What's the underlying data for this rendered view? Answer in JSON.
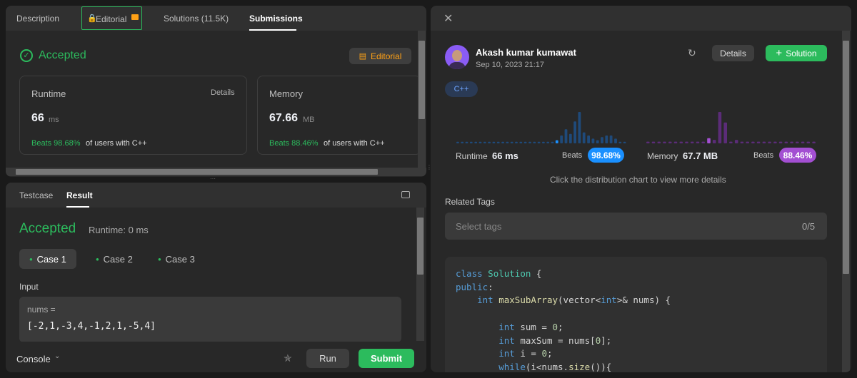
{
  "left_tabs": [
    {
      "label": "Description"
    },
    {
      "label": "Editorial"
    },
    {
      "label": "Solutions (11.5K)"
    },
    {
      "label": "Submissions"
    }
  ],
  "submission": {
    "status": "Accepted",
    "editorial_button": "Editorial",
    "runtime": {
      "title": "Runtime",
      "details": "Details",
      "value": "66",
      "unit": "ms",
      "beats": "Beats 98.68%",
      "suffix": "of users with C++"
    },
    "memory": {
      "title": "Memory",
      "value": "67.66",
      "unit": "MB",
      "beats": "Beats 88.46%",
      "suffix": "of users with C++"
    }
  },
  "bottom_panel": {
    "tabs": [
      {
        "label": "Testcase"
      },
      {
        "label": "Result"
      }
    ],
    "status": "Accepted",
    "runtime": "Runtime: 0 ms",
    "cases": [
      {
        "label": "Case 1"
      },
      {
        "label": "Case 2"
      },
      {
        "label": "Case 3"
      }
    ],
    "input_label": "Input",
    "input_name": "nums =",
    "input_value": "[-2,1,-3,4,-1,2,1,-5,4]",
    "console": "Console",
    "run": "Run",
    "submit": "Submit"
  },
  "detail": {
    "author": "Akash kumar kumawat",
    "date": "Sep 10, 2023 21:17",
    "details_button": "Details",
    "solution_button": "Solution",
    "language": "C++",
    "runtime_label": "Runtime",
    "runtime_value": "66 ms",
    "beats_label": "Beats",
    "runtime_beats": "98.68%",
    "memory_label": "Memory",
    "memory_value": "67.7 MB",
    "memory_beats": "88.46%",
    "hint": "Click the distribution chart to view more details",
    "related_tags": "Related Tags",
    "tags_placeholder": "Select tags",
    "tags_count": "0/5"
  },
  "colors": {
    "accent_green": "#2cbb5d",
    "accent_blue": "#1a90ff",
    "accent_purple": "#a34fd2",
    "editorial_orange": "#ffa116"
  },
  "runtime_distribution": [
    1,
    1,
    1,
    1,
    1,
    1,
    1,
    1,
    1,
    1,
    1,
    1,
    1,
    1,
    1,
    1,
    1,
    1,
    1,
    1,
    1,
    1,
    2,
    5,
    9,
    6,
    14,
    20,
    7,
    5,
    3,
    2,
    4,
    5,
    5,
    3,
    1,
    1
  ],
  "memory_distribution": [
    1,
    1,
    1,
    1,
    1,
    1,
    1,
    1,
    1,
    1,
    1,
    3,
    2,
    18,
    12,
    1,
    2,
    1,
    1,
    1,
    1,
    1,
    1,
    1,
    1,
    1,
    1,
    1,
    1,
    1,
    1
  ]
}
